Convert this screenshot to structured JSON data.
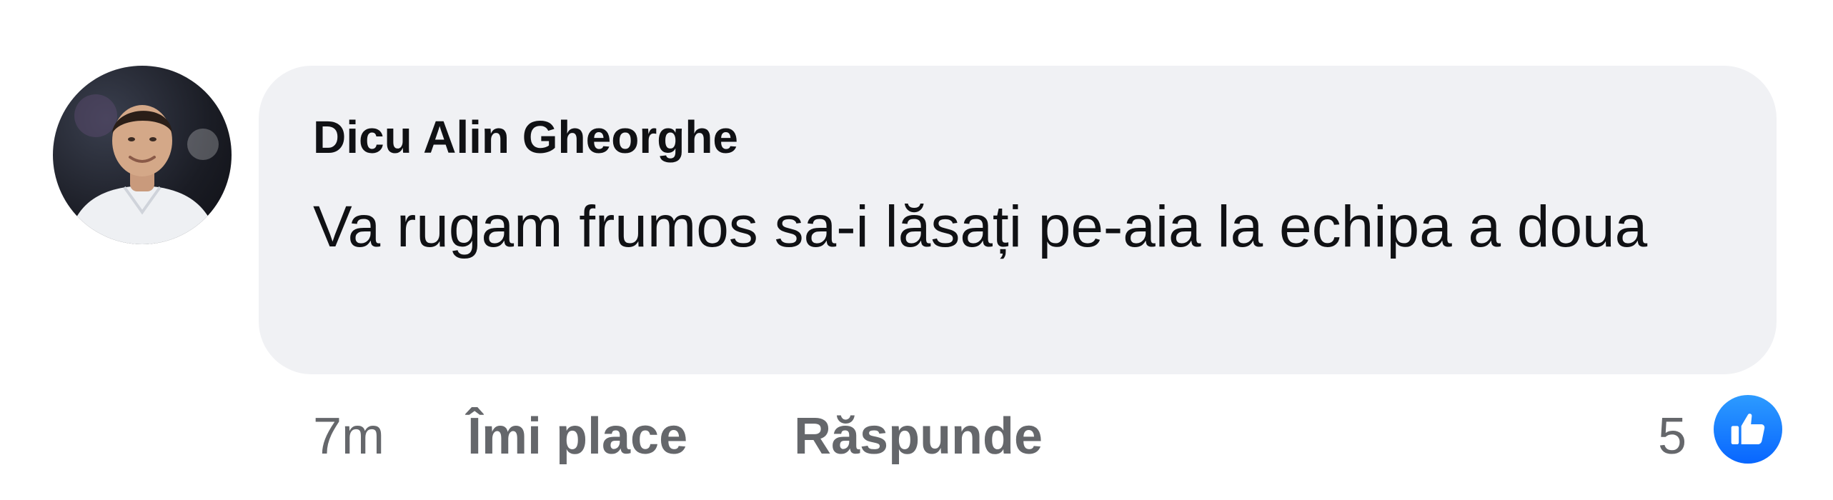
{
  "comment": {
    "author": "Dicu Alin Gheorghe",
    "text": "Va rugam frumos sa-i lăsați pe-aia la echipa a doua",
    "time": "7m",
    "like_label": "Îmi place",
    "reply_label": "Răspunde",
    "reaction_count": "5",
    "reaction_icon": "thumbs-up-icon"
  },
  "colors": {
    "bubble": "#f0f1f4",
    "text": "#101114",
    "secondary_text": "#65676b",
    "like_blue": "#0866ff"
  }
}
